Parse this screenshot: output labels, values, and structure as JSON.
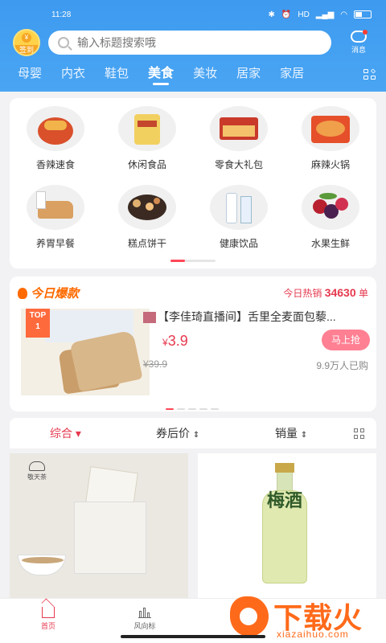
{
  "status": {
    "time": "11:28",
    "net": "HD",
    "battery": "46"
  },
  "header": {
    "signin_label": "签到",
    "signin_coin": "¥",
    "search_placeholder": "输入标题搜索哦",
    "message_label": "消息",
    "tabs": [
      "母婴",
      "内衣",
      "鞋包",
      "美食",
      "美妆",
      "居家",
      "家居"
    ],
    "active_tab": "美食"
  },
  "categories": [
    {
      "label": "香辣速食",
      "icon": "spicy-noodles"
    },
    {
      "label": "休闲食品",
      "icon": "snack-bag"
    },
    {
      "label": "零食大礼包",
      "icon": "gift-box"
    },
    {
      "label": "麻辣火锅",
      "icon": "hotpot"
    },
    {
      "label": "养胃早餐",
      "icon": "bread-milk"
    },
    {
      "label": "糕点饼干",
      "icon": "cookies"
    },
    {
      "label": "健康饮品",
      "icon": "drink-bottle"
    },
    {
      "label": "水果生鲜",
      "icon": "berries"
    }
  ],
  "hot": {
    "title": "今日爆款",
    "count_prefix": "今日热销",
    "count": "34630",
    "count_suffix": "单",
    "rank_badge": "TOP\n1",
    "product_name": "【李佳琦直播间】舌里全麦面包藜...",
    "price_symbol": "¥",
    "price": "3.9",
    "old_price": "¥39.9",
    "sold": "9.9万人已购",
    "buy_label": "马上抢"
  },
  "sort": {
    "items": [
      "综合",
      "券后价",
      "销量"
    ],
    "active": "综合"
  },
  "products": [
    {
      "brand": "敬天茶",
      "icon": "tea-bag-product"
    },
    {
      "label_text": "梅酒",
      "icon": "plum-wine-bottle"
    }
  ],
  "bottom_nav": {
    "items": [
      "首页",
      "风向标"
    ],
    "active": "首页"
  },
  "watermark": {
    "big": "下载火",
    "small": "xiazaihuo.com"
  },
  "colors": {
    "primary_blue": "#3d9aef",
    "accent_red": "#e6394f",
    "hot_orange": "#ff6a00"
  }
}
